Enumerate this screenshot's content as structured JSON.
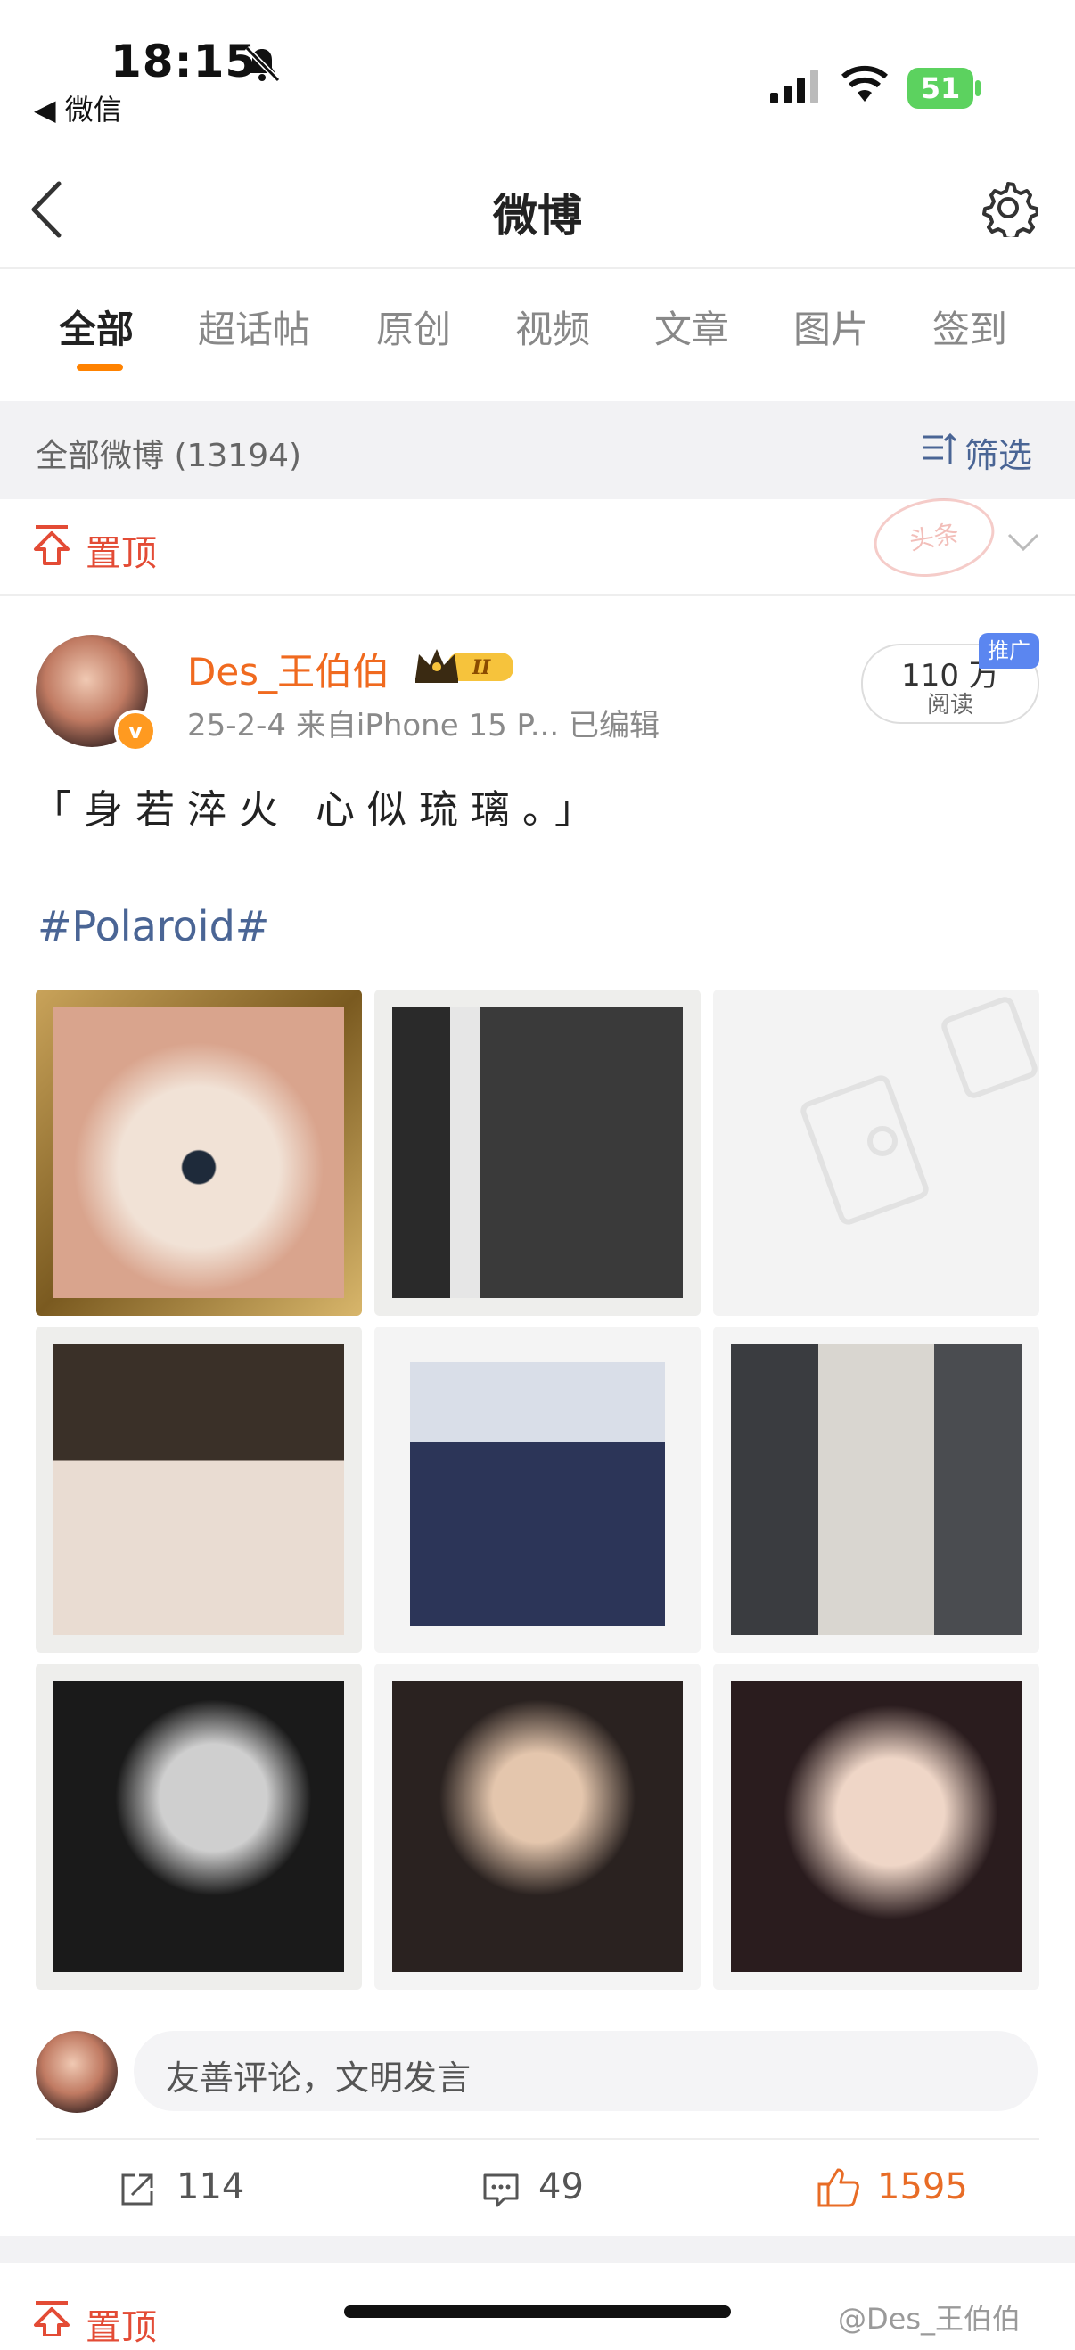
{
  "status_bar": {
    "time": "18:15",
    "back_app": "◀ 微信",
    "battery": "51"
  },
  "header": {
    "title": "微博"
  },
  "tabs": [
    {
      "label": "全部",
      "active": true
    },
    {
      "label": "超话帖"
    },
    {
      "label": "原创"
    },
    {
      "label": "视频"
    },
    {
      "label": "文章"
    },
    {
      "label": "图片"
    },
    {
      "label": "签到"
    }
  ],
  "filter_bar": {
    "count_label": "全部微博 (13194)",
    "filter_label": "筛选"
  },
  "pinned": {
    "label": "置顶",
    "stamp": "头条"
  },
  "post": {
    "username": "Des_王伯伯",
    "rank_badge": "II",
    "meta": "25-2-4  来自iPhone 15 P...  已编辑",
    "reads_value": "110 万",
    "reads_label": "阅读",
    "promo_tag": "推广",
    "text": "「身若淬火 心似琉璃。」",
    "hashtag": "#Polaroid#"
  },
  "comment": {
    "placeholder": "友善评论，文明发言"
  },
  "actions": {
    "repost": "114",
    "comments": "49",
    "likes": "1595"
  },
  "next_pinned": {
    "label": "置顶"
  },
  "watermark": "@Des_王伯伯",
  "colors": {
    "accent": "#ff8200",
    "link": "#4a6595",
    "pin": "#e34b35",
    "like": "#e86c26"
  }
}
